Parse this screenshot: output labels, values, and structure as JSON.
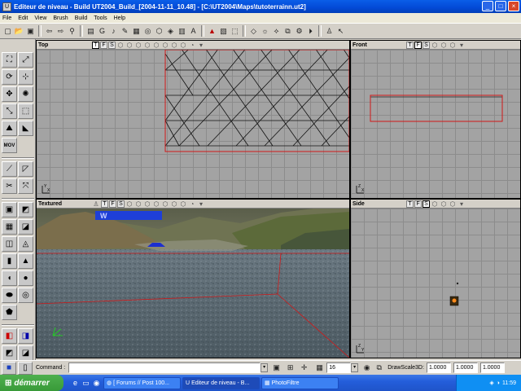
{
  "window": {
    "title": "Editeur de niveau - Build UT2004_Build_[2004-11-11_10.48] - [C:\\UT2004\\Maps\\tutoterrainn.ut2]",
    "buttons": [
      "_",
      "□",
      "×"
    ]
  },
  "menu": [
    "File",
    "Edit",
    "View",
    "Brush",
    "Build",
    "Tools",
    "Help"
  ],
  "viewports": {
    "top": {
      "title": "Top",
      "buttons": [
        "T",
        "F",
        "S"
      ],
      "axis": [
        "Y",
        "X"
      ]
    },
    "front": {
      "title": "Front",
      "buttons": [
        "T",
        "F",
        "S"
      ],
      "axis": [
        "Z",
        "X"
      ]
    },
    "textured": {
      "title": "Textured",
      "buttons": [
        "T",
        "F",
        "S"
      ]
    },
    "side": {
      "title": "Side",
      "buttons": [
        "T",
        "F",
        "S"
      ],
      "axis": [
        "Z",
        "Y"
      ]
    }
  },
  "statusbar": {
    "command_label": "Command :",
    "command_value": "",
    "grid_value": "16",
    "drawscale_label": "DrawScale3D:",
    "drawscale_x": "1.0000",
    "drawscale_y": "1.0000",
    "drawscale_z": "1.0000"
  },
  "taskbar": {
    "start_label": "démarrer",
    "tasks": [
      {
        "label": "[ Forums // Post 100...",
        "icon": "browser-icon",
        "active": false
      },
      {
        "label": "Editeur de niveau - B...",
        "icon": "unreal-icon",
        "active": true
      },
      {
        "label": "PhotoFiltre",
        "icon": "photofiltre-icon",
        "active": false
      }
    ],
    "clock": "11:59"
  },
  "colors": {
    "grid_bg": "#a3a3a3",
    "brush_red": "#d01818",
    "xp_blue": "#245edb",
    "start_green": "#389a38"
  }
}
